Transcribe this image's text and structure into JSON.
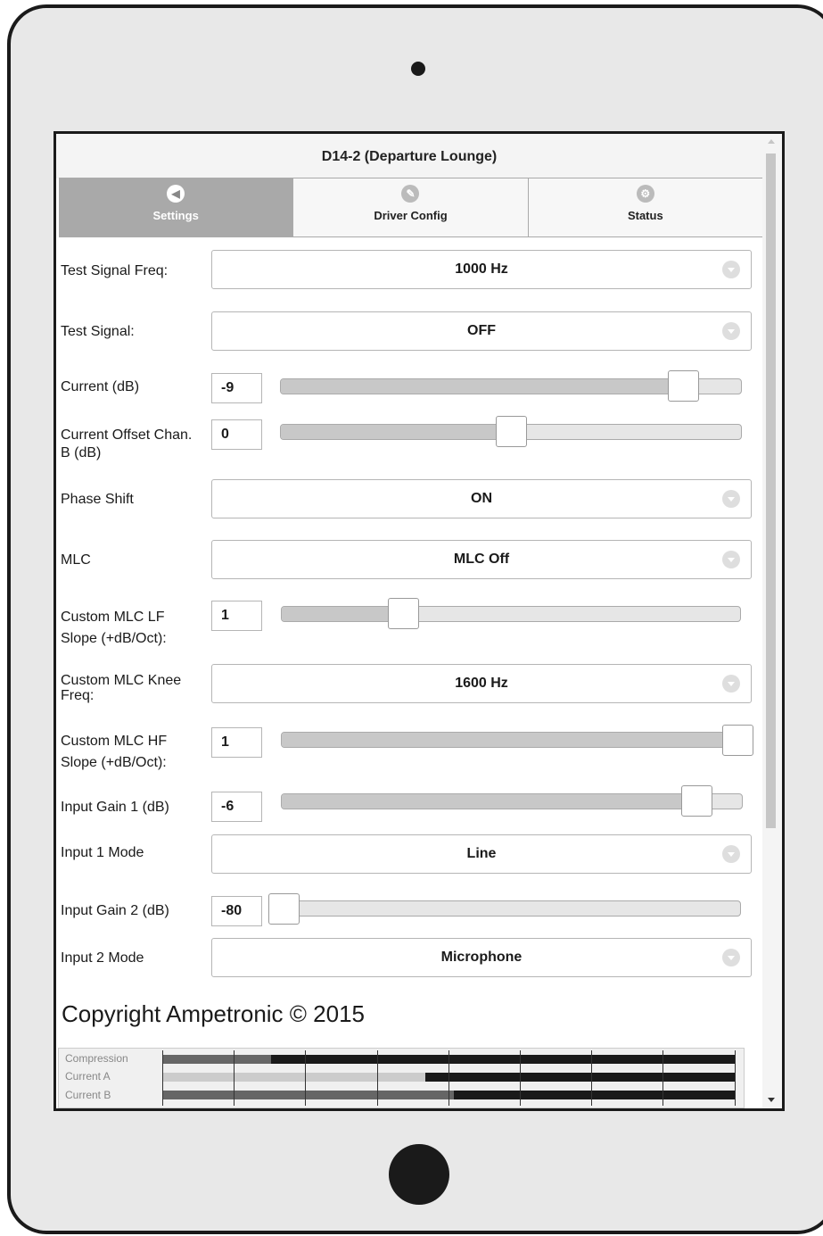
{
  "app": {
    "title": "D14-2 (Departure Lounge)"
  },
  "tabs": [
    {
      "label": "Settings",
      "icon": "speaker-icon"
    },
    {
      "label": "Driver Config",
      "icon": "pencil-icon"
    },
    {
      "label": "Status",
      "icon": "gear-icon"
    }
  ],
  "settings": {
    "test_signal_freq": {
      "label": "Test Signal Freq:",
      "value": "1000 Hz"
    },
    "test_signal": {
      "label": "Test Signal:",
      "value": "OFF"
    },
    "current": {
      "label": "Current (dB)",
      "value": "-9",
      "level": 0.9
    },
    "current_offset": {
      "label": "Current Offset Chan. B (dB)",
      "value": "0",
      "level": 0.5
    },
    "phase_shift": {
      "label": "Phase Shift",
      "value": "ON"
    },
    "mlc": {
      "label": "MLC",
      "value": "MLC Off"
    },
    "custom_mlc_lf": {
      "label": "Custom MLC LF Slope (+dB/Oct):",
      "value": "1",
      "level": 0.25
    },
    "custom_mlc_knee": {
      "label": "Custom MLC Knee Freq:",
      "value": "1600 Hz"
    },
    "custom_mlc_hf": {
      "label": "Custom MLC HF Slope (+dB/Oct):",
      "value": "1",
      "level": 1.0
    },
    "input_gain_1": {
      "label": "Input Gain 1 (dB)",
      "value": "-6",
      "level": 0.93
    },
    "input_1_mode": {
      "label": "Input 1 Mode",
      "value": "Line"
    },
    "input_gain_2": {
      "label": "Input Gain 2 (dB)",
      "value": "-80",
      "level": 0.0
    },
    "input_2_mode": {
      "label": "Input 2 Mode",
      "value": "Microphone"
    }
  },
  "footer": {
    "copyright": "Copyright Ampetronic © 2015"
  },
  "meters": [
    {
      "label": "Compression",
      "level": 0.19,
      "color": "#666666"
    },
    {
      "label": "Current A",
      "level": 0.46,
      "color": "#cccccc"
    },
    {
      "label": "Current B",
      "level": 0.51,
      "color": "#666666"
    }
  ]
}
